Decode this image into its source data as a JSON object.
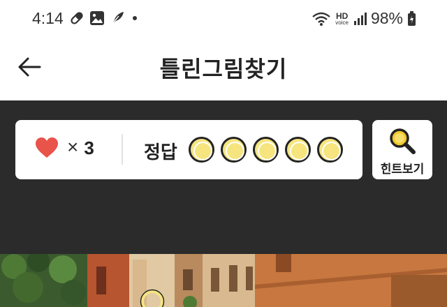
{
  "status_bar": {
    "time": "4:14",
    "hd_label": "HD",
    "voice_label": "voice",
    "battery": "98%"
  },
  "header": {
    "title": "틀린그림찾기"
  },
  "game": {
    "lives_count": "3",
    "times_symbol": "×",
    "answer_label": "정답",
    "answers_total": 5,
    "answers_found": 0,
    "hint_label": "힌트보기"
  },
  "icons": {
    "back": "arrow-left-icon",
    "heart": "heart-icon",
    "hint": "magnifier-icon"
  },
  "colors": {
    "heart": "#e8534a",
    "answer_circle": "#f6e57f",
    "game_background": "#2b2b2b",
    "magnifier": "#f0c92b"
  }
}
